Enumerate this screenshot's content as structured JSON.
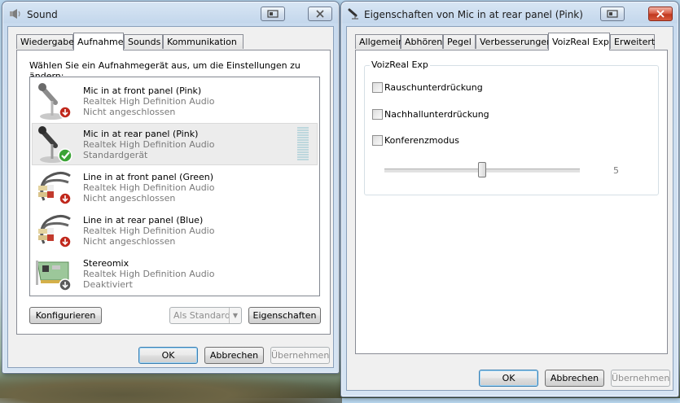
{
  "sound_window": {
    "title": "Sound",
    "tabs": [
      "Wiedergabe",
      "Aufnahme",
      "Sounds",
      "Kommunikation"
    ],
    "active_tab": "Aufnahme",
    "instruction": "Wählen Sie ein Aufnahmegerät aus, um die Einstellungen zu ändern:",
    "devices": [
      {
        "name": "Mic in at front panel (Pink)",
        "driver": "Realtek High Definition Audio",
        "status": "Nicht angeschlossen",
        "icon": "microphone-icon",
        "badge": "unplugged-badge-icon"
      },
      {
        "name": "Mic in at rear panel (Pink)",
        "driver": "Realtek High Definition Audio",
        "status": "Standardgerät",
        "icon": "microphone-icon",
        "badge": "default-checkmark-icon",
        "selected": true
      },
      {
        "name": "Line in at front panel (Green)",
        "driver": "Realtek High Definition Audio",
        "status": "Nicht angeschlossen",
        "icon": "rca-cable-icon",
        "badge": "unplugged-badge-icon"
      },
      {
        "name": "Line in at rear panel (Blue)",
        "driver": "Realtek High Definition Audio",
        "status": "Nicht angeschlossen",
        "icon": "rca-cable-icon",
        "badge": "unplugged-badge-icon"
      },
      {
        "name": "Stereomix",
        "driver": "Realtek High Definition Audio",
        "status": "Deaktiviert",
        "icon": "sound-card-icon",
        "badge": "disabled-badge-icon"
      }
    ],
    "buttons": {
      "configure": "Konfigurieren",
      "set_default": "Als Standard",
      "properties": "Eigenschaften",
      "ok": "OK",
      "cancel": "Abbrechen",
      "apply": "Übernehmen"
    }
  },
  "props_window": {
    "title": "Eigenschaften von Mic in at rear panel (Pink)",
    "tabs": [
      "Allgemein",
      "Abhören",
      "Pegel",
      "Verbesserungen",
      "VoizReal Exp",
      "Erweitert"
    ],
    "active_tab": "VoizReal Exp",
    "group_title": "VoizReal Exp",
    "options": [
      {
        "label": "Rauschunterdrückung",
        "checked": false
      },
      {
        "label": "Nachhallunterdrückung",
        "checked": false
      },
      {
        "label": "Konferenzmodus",
        "checked": false
      }
    ],
    "slider_value": "5",
    "slider_fraction": 0.5,
    "buttons": {
      "ok": "OK",
      "cancel": "Abbrechen",
      "apply": "Übernehmen"
    }
  },
  "colors": {
    "glass_frame": "#c4d7ec",
    "dialog_bg": "#f0f0f0",
    "close_button": "#c0381f",
    "checkmark_green": "#3aa335",
    "unplugged_red": "#c0281c"
  }
}
